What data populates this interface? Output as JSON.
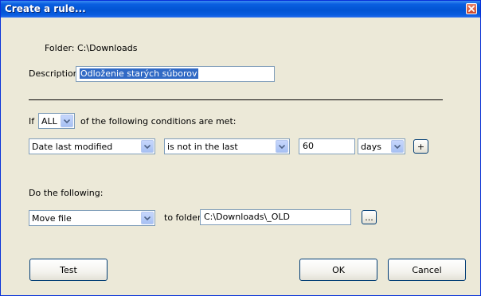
{
  "window": {
    "title": "Create a rule..."
  },
  "folder": {
    "label": "Folder: C:\\Downloads"
  },
  "description": {
    "label": "Description:",
    "value": "Odloženie starých súborov"
  },
  "conditions": {
    "if_label": "If",
    "match_selected": "ALL",
    "suffix_label": "of the following conditions are met:",
    "field_selected": "Date last modified",
    "operator_selected": "is not in the last",
    "amount_value": "60",
    "unit_selected": "days",
    "add_label": "+"
  },
  "actions": {
    "label": "Do the following:",
    "action_selected": "Move file",
    "to_folder_label": "to folder:",
    "folder_value": "C:\\Downloads\\_OLD",
    "browse_label": "..."
  },
  "buttons": {
    "test": "Test",
    "ok": "OK",
    "cancel": "Cancel"
  }
}
